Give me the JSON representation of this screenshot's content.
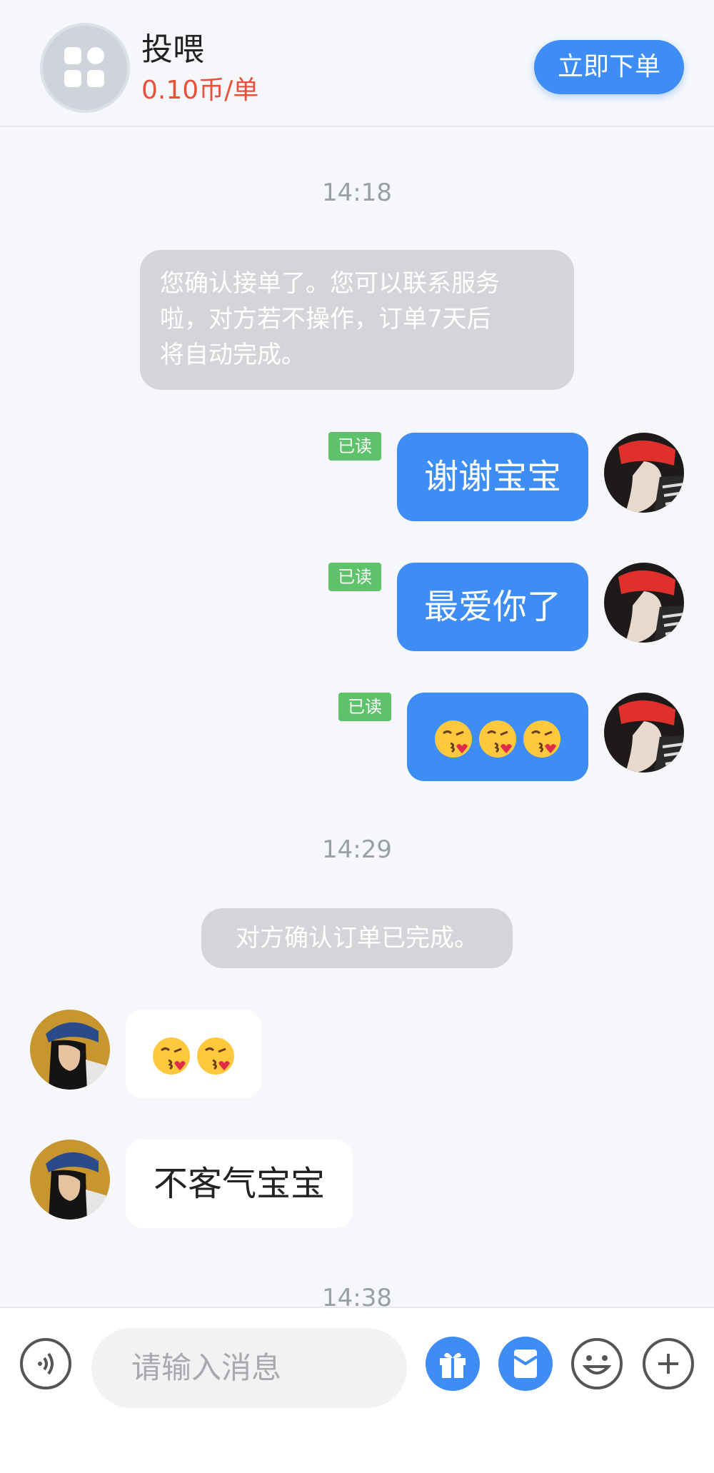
{
  "header": {
    "title": "投喂",
    "price": "0.10币/单",
    "order_button": "立即下单"
  },
  "chat": {
    "time_1": "14:18",
    "system_1_lines": [
      "您确认接单了。您可以联系服务",
      "啦，对方若不操作，订单7天后",
      "将自动完成。"
    ],
    "read_label": "已读",
    "my_messages": [
      "谢谢宝宝",
      "最爱你了"
    ],
    "my_emoji_count": 3,
    "time_2": "14:29",
    "system_2": "对方确认订单已完成。",
    "other_emoji_count": 2,
    "other_message": "不客气宝宝",
    "time_3": "14:38"
  },
  "input": {
    "placeholder": "请输入消息"
  },
  "icons": {
    "voice": "voice-icon",
    "gift": "gift-icon",
    "red_packet": "red-packet-icon",
    "emoji": "smiley-icon",
    "more": "plus-icon"
  },
  "colors": {
    "accent": "#3d8df5",
    "price": "#e8503a",
    "read_badge": "#5ec26a",
    "system_bubble": "#d3d5d8"
  }
}
